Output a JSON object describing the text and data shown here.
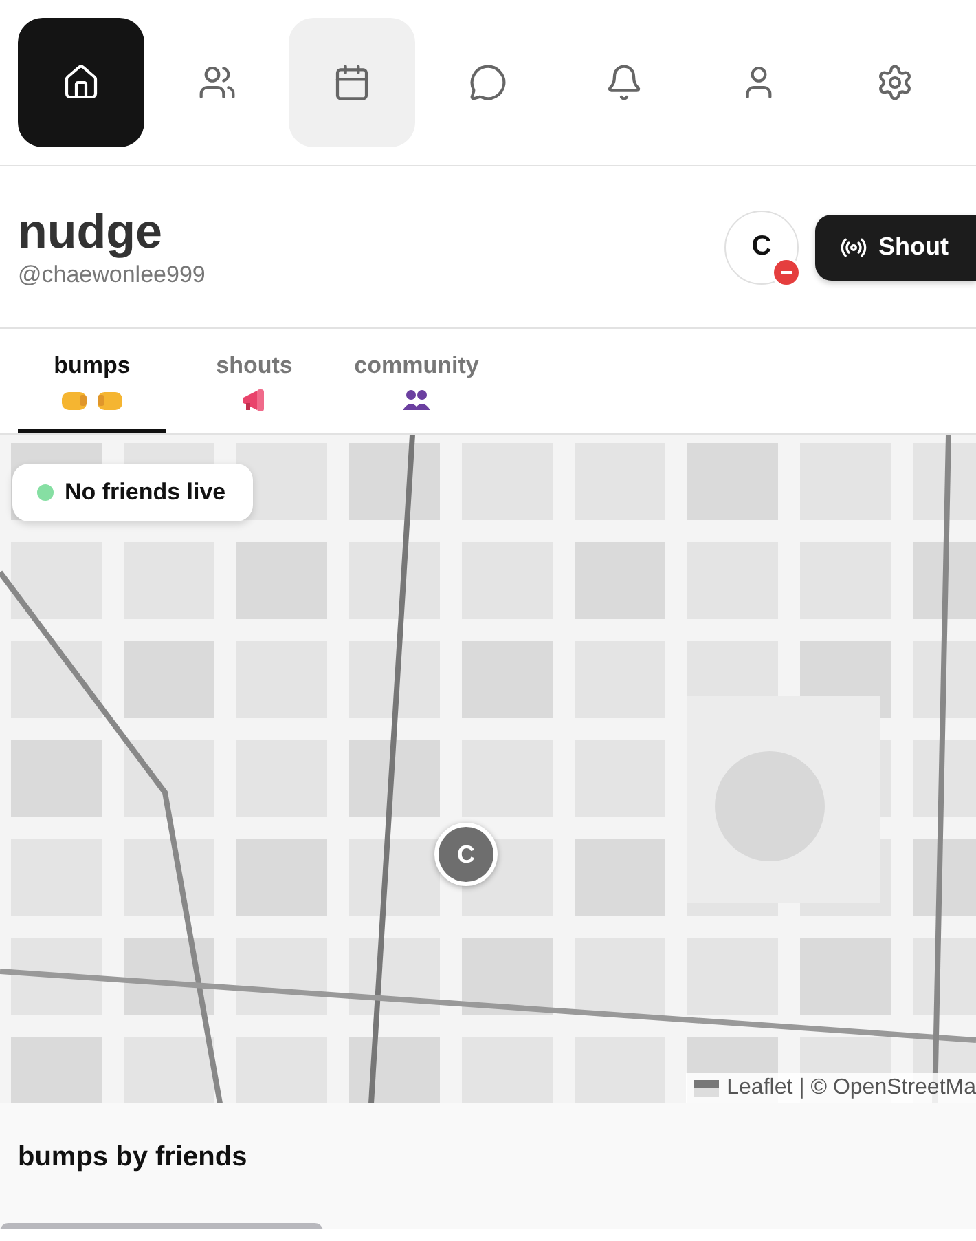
{
  "nav": [
    {
      "kind": "home",
      "selected": true,
      "hovered": false
    },
    {
      "kind": "friends",
      "selected": false,
      "hovered": false
    },
    {
      "kind": "calendar",
      "selected": false,
      "hovered": true
    },
    {
      "kind": "chat",
      "selected": false,
      "hovered": false
    },
    {
      "kind": "bell",
      "selected": false,
      "hovered": false
    },
    {
      "kind": "profile",
      "selected": false,
      "hovered": false
    },
    {
      "kind": "settings",
      "selected": false,
      "hovered": false
    }
  ],
  "header": {
    "title": "nudge",
    "handle": "@chaewonlee999",
    "avatar": "C",
    "do_not_disturb": true,
    "shout_button": "Shout"
  },
  "tabs": [
    {
      "label": "bumps",
      "kind": "fists",
      "selected": true
    },
    {
      "label": "shouts",
      "kind": "megaphone",
      "selected": false
    },
    {
      "label": "community",
      "kind": "people",
      "selected": false
    }
  ],
  "map": {
    "status": "No friends live",
    "marker": "C",
    "attribution": "Leaflet | © OpenStreetMa"
  },
  "section": {
    "title": "bumps by friends"
  }
}
